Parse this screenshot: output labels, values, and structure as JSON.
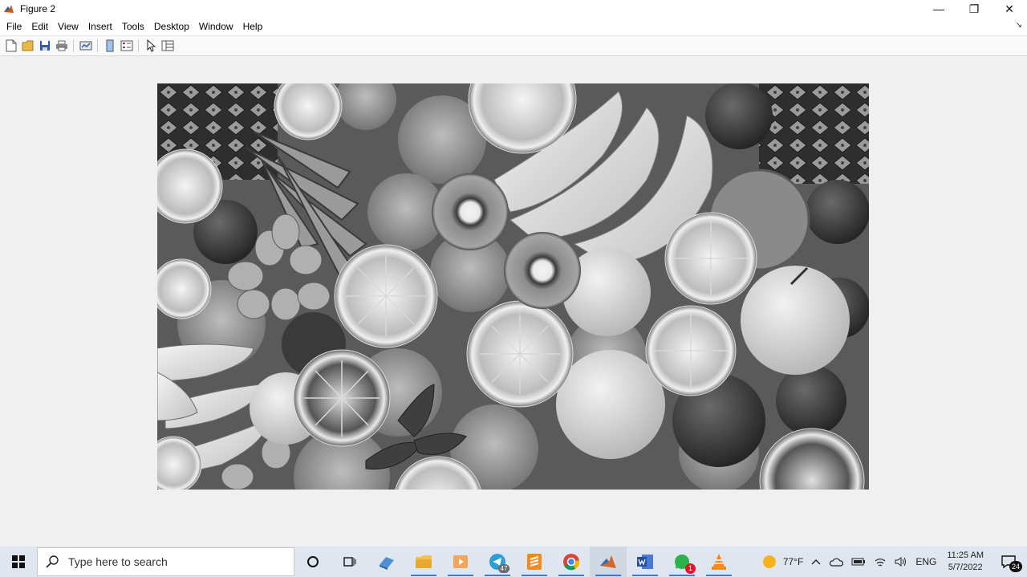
{
  "window": {
    "title": "Figure 2",
    "controls": {
      "minimize": "—",
      "restore": "❐",
      "close": "✕"
    }
  },
  "menu": {
    "items": [
      "File",
      "Edit",
      "View",
      "Insert",
      "Tools",
      "Desktop",
      "Window",
      "Help"
    ],
    "overflow": "↘"
  },
  "toolbar": {
    "buttons": [
      "new-figure",
      "open-file",
      "save",
      "print",
      "link-plot",
      "hide-plot-tools",
      "show-plot-tools",
      "edit-plot",
      "property-inspector"
    ]
  },
  "figure": {
    "image_description_icon": "grayscale-fruit-photo"
  },
  "taskbar": {
    "search_placeholder": "Type here to search",
    "apps": [
      "task-view",
      "python-idle",
      "file-explorer",
      "media-player",
      "telegram",
      "sublime",
      "chrome",
      "matlab",
      "word",
      "whatsapp",
      "vlc"
    ],
    "telegram_badge": "47",
    "whatsapp_badge": "1",
    "weather": "77°F",
    "language": "ENG",
    "time": "11:25 AM",
    "date": "5/7/2022",
    "notifications": "24"
  },
  "colors": {
    "taskbar": "#dfe6ef",
    "accent": "#3b7cd6",
    "badge": "#e81123"
  }
}
